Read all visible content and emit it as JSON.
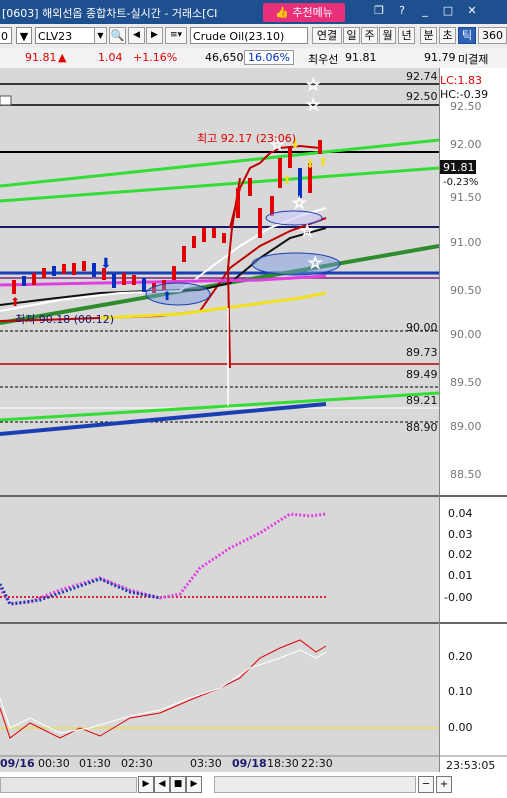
{
  "window": {
    "title": "[0603] 해외선옵 종합차트-실시간 - 거래소[CI",
    "recommend_label": "추천메뉴",
    "controls": [
      "❐",
      "?",
      "_",
      "□",
      "✕"
    ]
  },
  "toolbar": {
    "left_box": "0",
    "symbol": "CLV23",
    "search_icon": "search-icon",
    "instrument_name": "Crude Oil(23.10)",
    "link_label": "연결",
    "period_buttons": [
      "일",
      "주",
      "월",
      "년",
      "분",
      "초",
      "틱",
      "360"
    ],
    "active_period": "틱"
  },
  "price_bar": {
    "last": "91.81",
    "arrow": "▲",
    "change": "1.04",
    "change_pct": "+1.16%",
    "volume": "46,650",
    "volume_pct": "16.06%",
    "best_bid_label": "최우선",
    "best_bid": "91.81",
    "best_ask": "91.79",
    "unfilled_label": "미결제"
  },
  "colors": {
    "up": "#e00000",
    "down": "#0030c0",
    "chart_bg": "#d8d8d8",
    "green_line": "#33dd33",
    "dark_green": "#2e8b2e",
    "blue_line": "#1a3fb3",
    "magenta": "#e040e0",
    "yellow": "#f0e020"
  },
  "main_chart": {
    "lc_label": "LC:1.83",
    "hc_label": "HC:-0.39",
    "high_label": "최고 92.17 (23:06)",
    "low_label": "최저 90.18 (00:12)",
    "current_price": "91.81",
    "current_pct": "-0.23%",
    "line_labels": [
      "92.74",
      "92.50",
      "90.00",
      "89.73",
      "89.49",
      "89.21",
      "88.90"
    ],
    "axis_ticks": [
      "92.50",
      "92.00",
      "91.50",
      "91.00",
      "90.50",
      "90.00",
      "89.50",
      "89.00",
      "88.50"
    ]
  },
  "indicator1": {
    "axis_ticks": [
      "0.04",
      "0.03",
      "0.02",
      "0.01",
      "-0.00"
    ]
  },
  "indicator2": {
    "axis_ticks": [
      "0.20",
      "0.10",
      "0.00"
    ]
  },
  "time_axis": {
    "labels": [
      "09/16",
      "00:30",
      "01:30",
      "02:30",
      "03:30",
      "09/18",
      "18:30",
      "22:30"
    ],
    "current_time": "23:53:05"
  },
  "nav_buttons": [
    "▶",
    "◀",
    "■",
    "▶",
    "─",
    "+"
  ]
}
